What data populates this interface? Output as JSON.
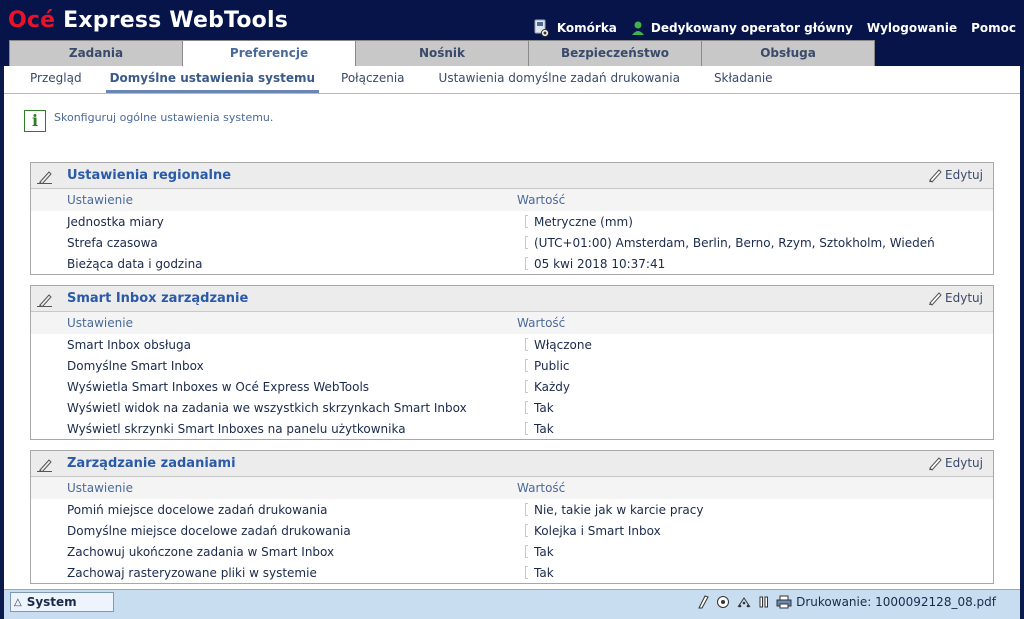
{
  "app": {
    "brand": "Océ",
    "title": "Express WebTools"
  },
  "usernav": {
    "cell": "Komórka",
    "operator": "Dedykowany operator główny",
    "logout": "Wylogowanie",
    "help": "Pomoc"
  },
  "tabs": [
    {
      "label": "Zadania"
    },
    {
      "label": "Preferencje"
    },
    {
      "label": "Nośnik"
    },
    {
      "label": "Bezpieczeństwo"
    },
    {
      "label": "Obsługa"
    }
  ],
  "subtabs": [
    {
      "label": "Przegląd"
    },
    {
      "label": "Domyślne ustawienia systemu"
    },
    {
      "label": "Połączenia"
    },
    {
      "label": "Ustawienia domyślne zadań drukowania"
    },
    {
      "label": "Składanie"
    }
  ],
  "info": {
    "text": "Skonfiguruj ogólne ustawienia systemu."
  },
  "columns": {
    "setting": "Ustawienie",
    "value": "Wartość"
  },
  "edit_label": "Edytuj",
  "panels": [
    {
      "title": "Ustawienia regionalne",
      "rows": [
        {
          "setting": "Jednostka miary",
          "value": "Metryczne (mm)"
        },
        {
          "setting": "Strefa czasowa",
          "value": "(UTC+01:00) Amsterdam, Berlin, Berno, Rzym, Sztokholm, Wiedeń"
        },
        {
          "setting": "Bieżąca data i godzina",
          "value": "05 kwi 2018 10:37:41"
        }
      ]
    },
    {
      "title": "Smart Inbox zarządzanie",
      "rows": [
        {
          "setting": "Smart Inbox obsługa",
          "value": "Włączone"
        },
        {
          "setting": "Domyślne Smart Inbox",
          "value": "Public"
        },
        {
          "setting": "Wyświetla Smart Inboxes w Océ Express WebTools",
          "value": "Każdy"
        },
        {
          "setting": "Wyświetl widok na zadania we wszystkich skrzynkach Smart Inbox",
          "value": "Tak"
        },
        {
          "setting": "Wyświetl skrzynki Smart Inboxes na panelu użytkownika",
          "value": "Tak"
        }
      ]
    },
    {
      "title": "Zarządzanie zadaniami",
      "rows": [
        {
          "setting": "Pomiń miejsce docelowe zadań drukowania",
          "value": "Nie, takie jak w karcie pracy"
        },
        {
          "setting": "Domyślne miejsce docelowe zadań drukowania",
          "value": "Kolejka i Smart Inbox"
        },
        {
          "setting": "Zachowuj ukończone zadania w Smart Inbox",
          "value": "Tak"
        },
        {
          "setting": "Zachowaj rasteryzowane pliki w systemie",
          "value": "Tak"
        }
      ]
    }
  ],
  "statusbar": {
    "system_label": "System",
    "printing": "Drukowanie: 1000092128_08.pdf"
  },
  "colors": {
    "header_bg": "#06144a",
    "brand_red": "#e8132a",
    "panel_title": "#2a5aa8",
    "status_bg": "#c9ddf0"
  }
}
